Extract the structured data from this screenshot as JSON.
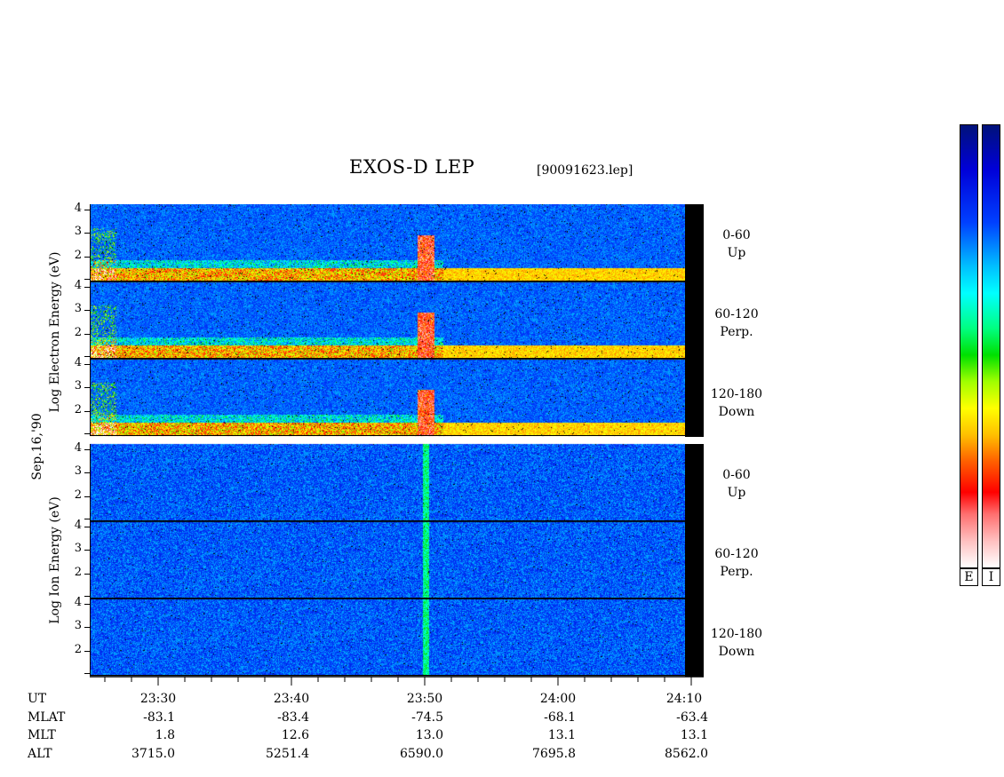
{
  "header": {
    "title": "EXOS-D LEP",
    "file": "[90091623.lep]"
  },
  "date_label": "Sep.16,'90",
  "electron": {
    "ylabel": "Log Electron Energy (eV)",
    "ticks": [
      "4",
      "3",
      "2"
    ],
    "pitch_angles": [
      {
        "range": "0-60",
        "name": "Up"
      },
      {
        "range": "60-120",
        "name": "Perp."
      },
      {
        "range": "120-180",
        "name": "Down"
      }
    ]
  },
  "ion": {
    "ylabel": "Log Ion Energy (eV)",
    "ticks": [
      "4",
      "3",
      "2"
    ],
    "pitch_angles": [
      {
        "range": "0-60",
        "name": "Up"
      },
      {
        "range": "60-120",
        "name": "Perp."
      },
      {
        "range": "120-180",
        "name": "Down"
      }
    ]
  },
  "colorbar": {
    "labels": [
      "E",
      "I"
    ]
  },
  "orbit": {
    "rows": [
      {
        "name": "UT",
        "values": [
          "23:30",
          "23:40",
          "23:50",
          "24:00",
          "24:10"
        ]
      },
      {
        "name": "MLAT",
        "values": [
          "-83.1",
          "-83.4",
          "-74.5",
          "-68.1",
          "-63.4"
        ]
      },
      {
        "name": "MLT",
        "values": [
          "1.8",
          "12.6",
          "13.0",
          "13.1",
          "13.1"
        ]
      },
      {
        "name": "ALT",
        "values": [
          "3715.0",
          "5251.4",
          "6590.0",
          "7695.8",
          "8562.0"
        ]
      }
    ]
  },
  "chart_data": {
    "type": "heatmap",
    "title": "EXOS-D LEP",
    "x": [
      "23:30",
      "23:40",
      "23:50",
      "24:00",
      "24:10"
    ],
    "xlabel": "UT",
    "panels": [
      {
        "species": "Electron",
        "pitch_angle": "0-60 Up",
        "ylim": [
          1,
          4.2
        ]
      },
      {
        "species": "Electron",
        "pitch_angle": "60-120 Perp.",
        "ylim": [
          1,
          4.2
        ]
      },
      {
        "species": "Electron",
        "pitch_angle": "120-180 Down",
        "ylim": [
          1,
          4.2
        ]
      },
      {
        "species": "Ion",
        "pitch_angle": "0-60 Up",
        "ylim": [
          1,
          4.2
        ]
      },
      {
        "species": "Ion",
        "pitch_angle": "60-120 Perp.",
        "ylim": [
          1,
          4.2
        ]
      },
      {
        "species": "Ion",
        "pitch_angle": "120-180 Down",
        "ylim": [
          1,
          4.2
        ]
      }
    ]
  }
}
